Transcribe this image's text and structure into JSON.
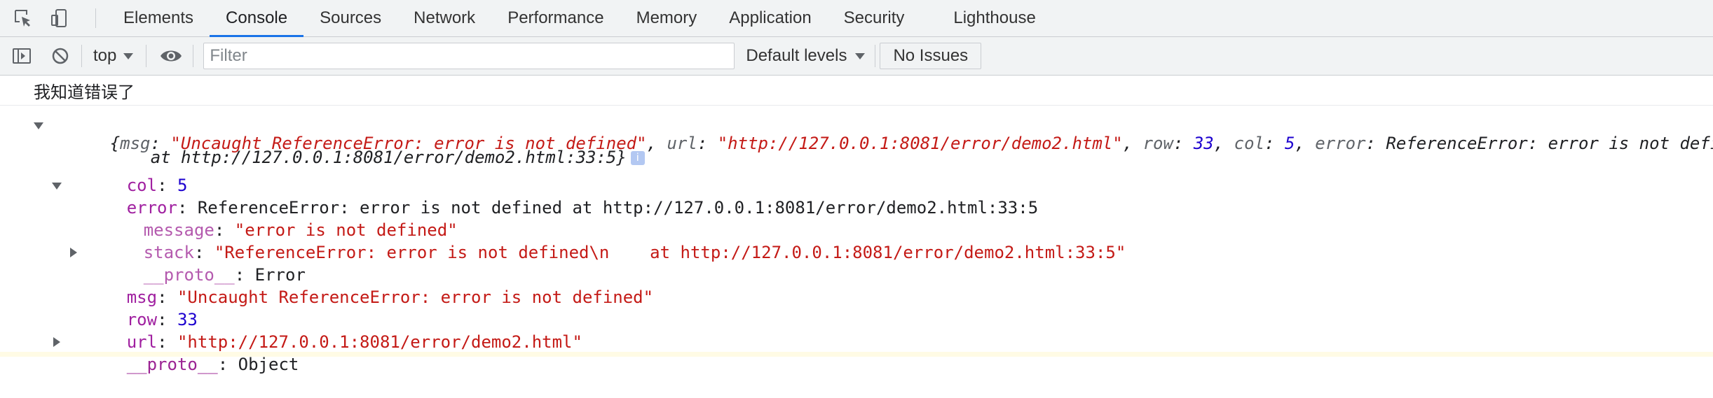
{
  "tabs": [
    {
      "label": "Elements",
      "active": false
    },
    {
      "label": "Console",
      "active": true
    },
    {
      "label": "Sources",
      "active": false
    },
    {
      "label": "Network",
      "active": false
    },
    {
      "label": "Performance",
      "active": false
    },
    {
      "label": "Memory",
      "active": false
    },
    {
      "label": "Application",
      "active": false
    },
    {
      "label": "Security",
      "active": false
    },
    {
      "label": "Lighthouse",
      "active": false
    }
  ],
  "toolbar": {
    "context": "top",
    "filter_placeholder": "Filter",
    "levels": "Default levels",
    "issues": "No Issues"
  },
  "console": {
    "log_text": "我知道错误了",
    "summary": {
      "open": "{",
      "k_msg": "msg",
      "v_msg": "\"Uncaught ReferenceError: error is not defined\"",
      "k_url": "url",
      "v_url": "\"http://127.0.0.1:8081/error/demo2.html\"",
      "k_row": "row",
      "v_row": "33",
      "k_col": "col",
      "v_col": "5",
      "k_error": "error",
      "v_error": "ReferenceError: error is not defined",
      "line2": "at http://127.0.0.1:8081/error/demo2.html:33:5}",
      "info": "i",
      "sep": ", ",
      "colon": ": "
    },
    "props": {
      "col_key": "col",
      "col_val": "5",
      "error_key": "error",
      "error_val": "ReferenceError: error is not defined at http://127.0.0.1:8081/error/demo2.html:33:5",
      "message_key": "message",
      "message_val": "\"error is not defined\"",
      "stack_key": "stack",
      "stack_val": "\"ReferenceError: error is not defined\\n    at http://127.0.0.1:8081/error/demo2.html:33:5\"",
      "err_proto_key": "__proto__",
      "err_proto_val": "Error",
      "msg_key": "msg",
      "msg_val": "\"Uncaught ReferenceError: error is not defined\"",
      "row_key": "row",
      "row_val": "33",
      "url_key": "url",
      "url_val": "\"http://127.0.0.1:8081/error/demo2.html\"",
      "proto_key": "__proto__",
      "proto_val": "Object",
      "colon": ": "
    }
  },
  "colors": {
    "accent": "#1a73e8",
    "string": "#c41a16",
    "number": "#1c00cf",
    "property": "#a020a0"
  },
  "icons": [
    "inspect-element-icon",
    "device-toggle-icon",
    "sidebar-toggle-icon",
    "clear-console-icon",
    "eye-icon"
  ]
}
